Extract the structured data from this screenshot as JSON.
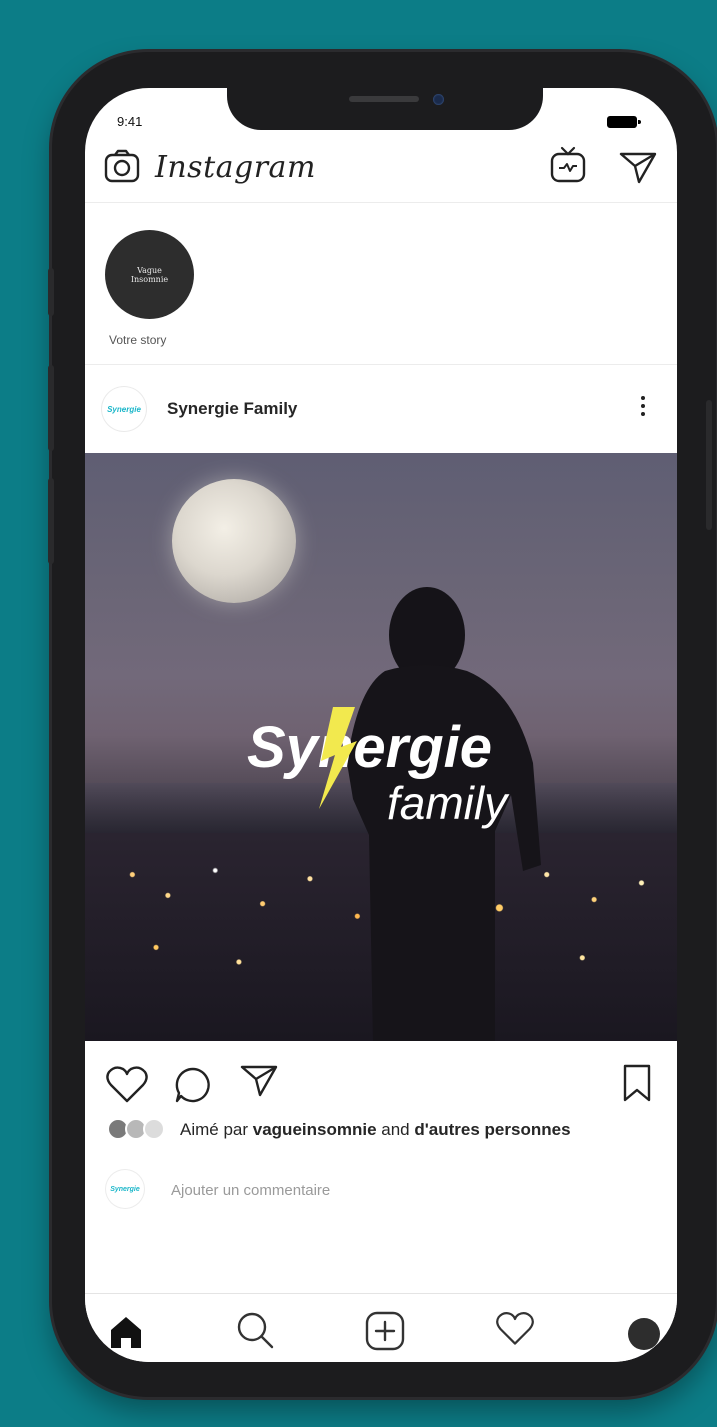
{
  "status_bar": {
    "time": "9:41"
  },
  "header": {
    "app_title": "Instagram"
  },
  "stories": {
    "own_avatar_text": "Vague\nInsomnie",
    "own_label": "Votre story"
  },
  "post": {
    "author": "Synergie Family",
    "author_avatar_text": "Synergie",
    "image": {
      "logo_word_1": "Synergie",
      "logo_word_2": "family"
    },
    "likes": {
      "prefix": "Aimé par",
      "user": "vagueinsomnie",
      "connector": "and",
      "others": "d'autres personnes"
    },
    "comment_placeholder": "Ajouter un commentaire",
    "comment_avatar_text": "Synergie"
  },
  "colors": {
    "background": "#0c7d87",
    "brand_accent": "#f2e94e",
    "link_teal": "#1ab6c9"
  },
  "icons": {
    "header": [
      "camera-icon",
      "igtv-icon",
      "direct-send-icon"
    ],
    "actions": [
      "heart-icon",
      "comment-icon",
      "share-icon",
      "bookmark-icon"
    ],
    "tabs": [
      "home-icon",
      "search-icon",
      "add-post-icon",
      "activity-icon",
      "profile-icon"
    ]
  }
}
